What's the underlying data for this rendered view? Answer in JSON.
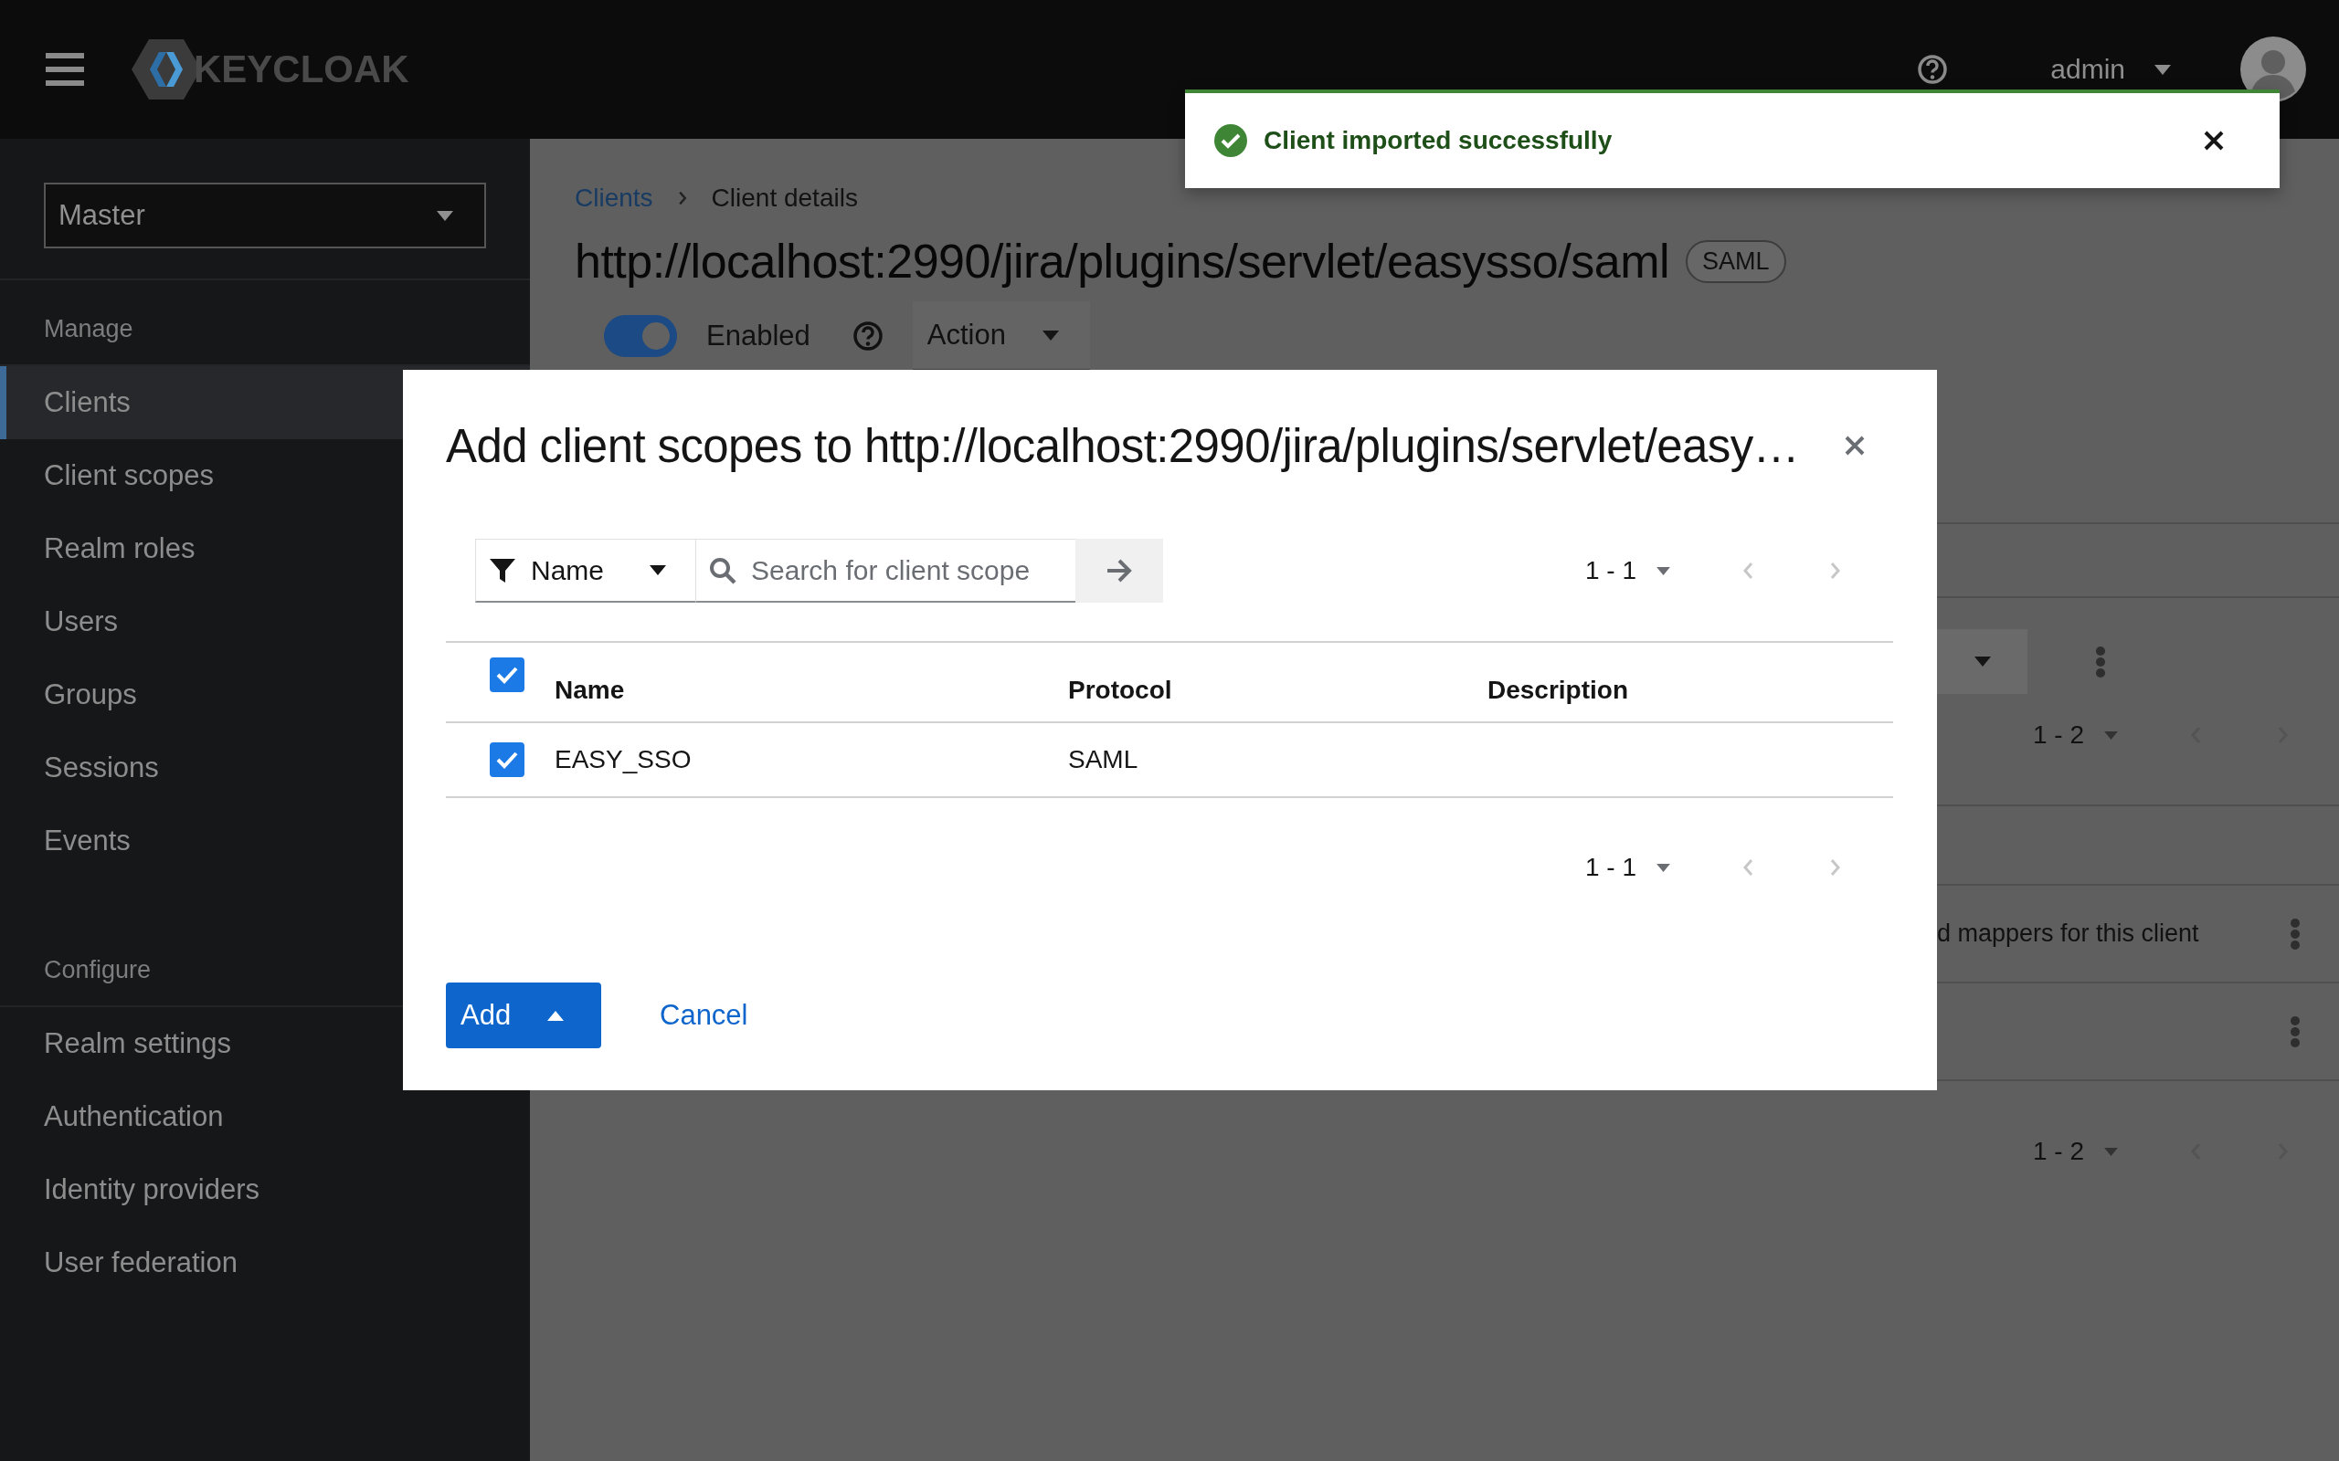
{
  "header": {
    "logo_text": "KEYCLOAK",
    "user": "admin"
  },
  "toast": {
    "kind": "success",
    "message": "Client imported successfully"
  },
  "sidebar": {
    "realm": "Master",
    "sections": [
      {
        "title": "Manage",
        "items": [
          {
            "label": "Clients",
            "selected": true
          },
          {
            "label": "Client scopes",
            "selected": false
          },
          {
            "label": "Realm roles",
            "selected": false
          },
          {
            "label": "Users",
            "selected": false
          },
          {
            "label": "Groups",
            "selected": false
          },
          {
            "label": "Sessions",
            "selected": false
          },
          {
            "label": "Events",
            "selected": false
          }
        ]
      },
      {
        "title": "Configure",
        "items": [
          {
            "label": "Realm settings",
            "selected": false
          },
          {
            "label": "Authentication",
            "selected": false
          },
          {
            "label": "Identity providers",
            "selected": false
          },
          {
            "label": "User federation",
            "selected": false
          }
        ]
      }
    ]
  },
  "page": {
    "breadcrumb": [
      {
        "label": "Clients",
        "kind": "link"
      },
      {
        "label": "Client details",
        "kind": "current"
      }
    ],
    "title": "http://localhost:2990/jira/plugins/servlet/easysso/saml",
    "badge": "SAML",
    "enabled_toggle": {
      "label": "Enabled",
      "on": true
    },
    "action_menu": "Action",
    "pagination_top": "1 - 2",
    "row_text": "d mappers for this client",
    "pagination_bottom": "1 - 2"
  },
  "modal": {
    "title": "Add client scopes to http://localhost:2990/jira/plugins/servlet/easy…",
    "filter": "Name",
    "search": {
      "placeholder": "Search for client scope"
    },
    "pagination_top": "1 - 1",
    "table": {
      "all_checked": true,
      "columns": [
        "Name",
        "Protocol",
        "Description"
      ],
      "rows": [
        {
          "checked": true,
          "cells": [
            "EASY_SSO",
            "SAML"
          ]
        }
      ]
    },
    "pagination_bottom": "1 - 1",
    "buttons": [
      {
        "label": "Add",
        "kind": "split-primary"
      },
      {
        "label": "Cancel",
        "kind": "link"
      }
    ]
  }
}
